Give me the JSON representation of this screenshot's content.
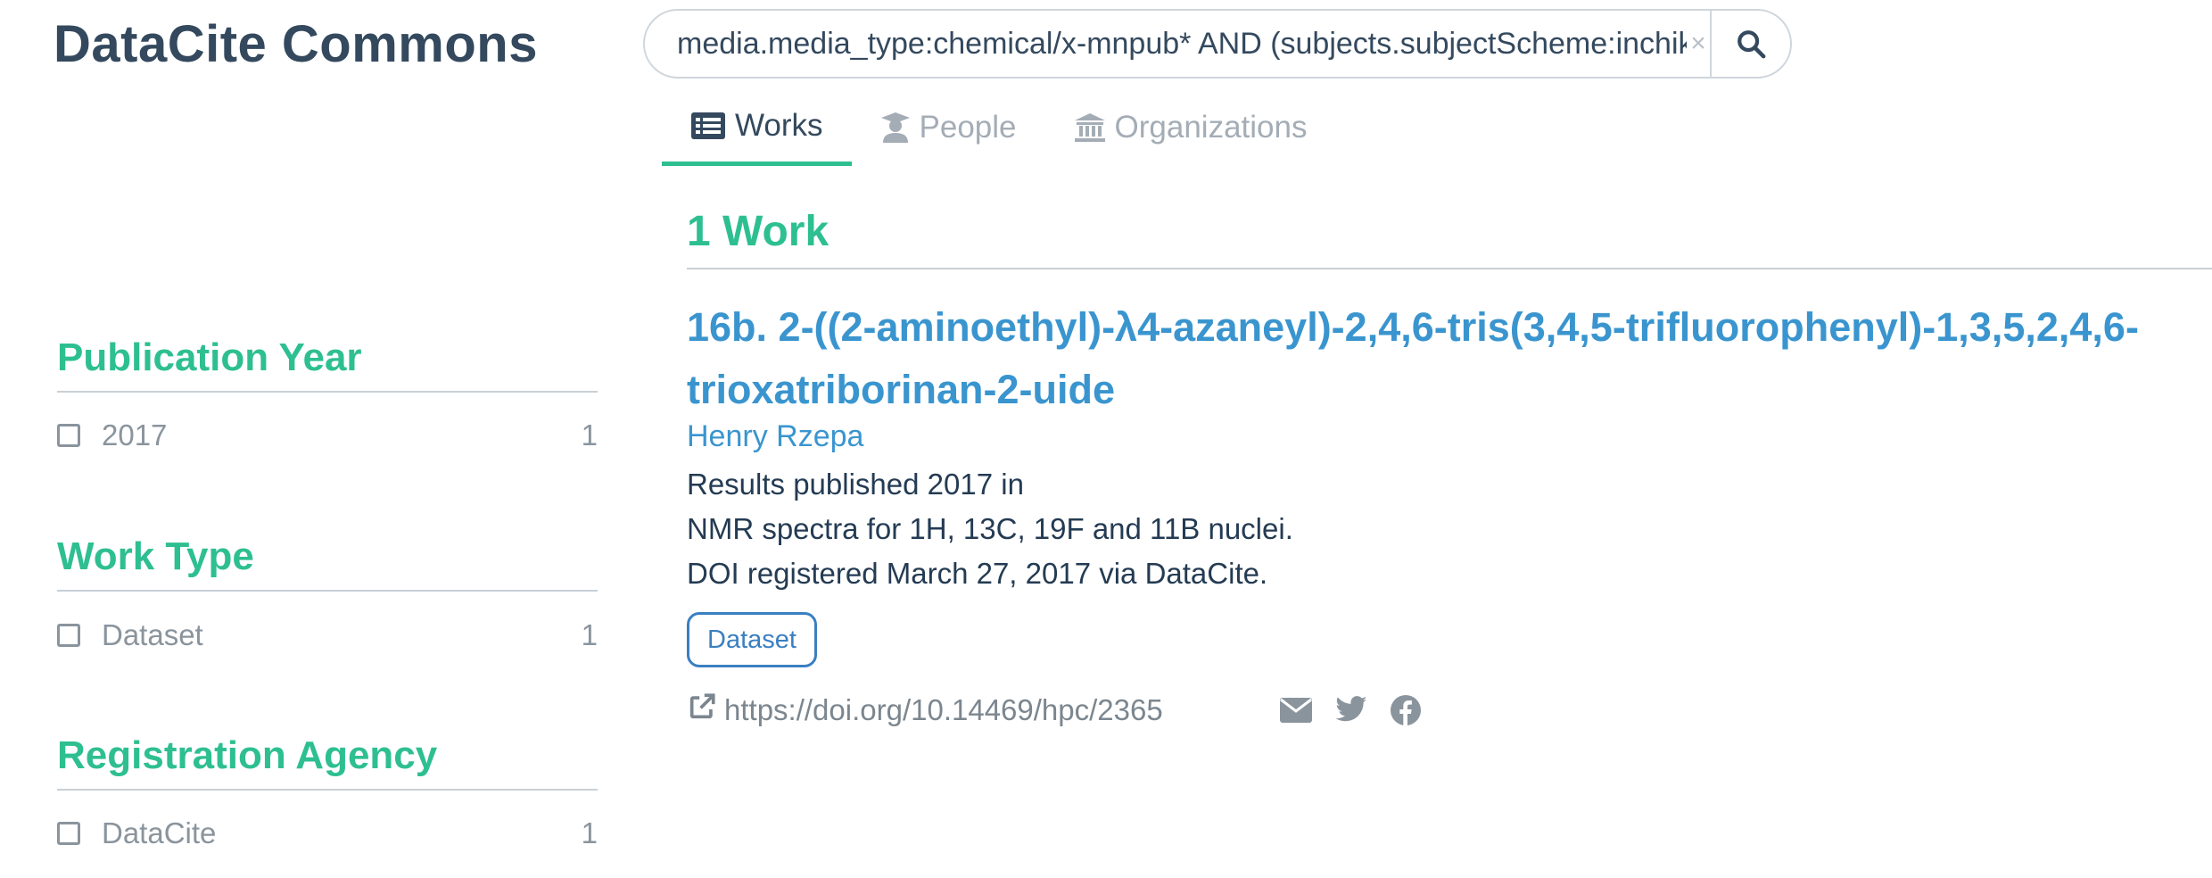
{
  "brand": "DataCite Commons",
  "search": {
    "value": "media.media_type:chemical/x-mnpub* AND (subjects.subjectScheme:inchikey)"
  },
  "tabs": [
    {
      "label": "Works",
      "icon": "list-alt-icon"
    },
    {
      "label": "People",
      "icon": "user-graduate-icon"
    },
    {
      "label": "Organizations",
      "icon": "university-icon"
    }
  ],
  "results": {
    "count_label": "1 Work"
  },
  "facets": [
    {
      "title": "Publication Year",
      "items": [
        {
          "label": "2017",
          "count": "1"
        }
      ]
    },
    {
      "title": "Work Type",
      "items": [
        {
          "label": "Dataset",
          "count": "1"
        }
      ]
    },
    {
      "title": "Registration Agency",
      "items": [
        {
          "label": "DataCite",
          "count": "1"
        }
      ]
    }
  ],
  "work": {
    "title_line1": "16b. 2-((2-aminoethyl)-λ4-azaneyl)-2,4,6-tris(3,4,5-trifluorophenyl)-1,3,5,2,4,6-",
    "title_line2": "trioxatriborinan-2-uide",
    "creator": "Henry Rzepa",
    "published": "Results published 2017 in",
    "description": "NMR spectra for 1H, 13C, 19F and 11B nuclei.",
    "registered": "DOI registered March 27, 2017 via DataCite.",
    "type_badge": "Dataset",
    "doi_url": "https://doi.org/10.14469/hpc/2365"
  },
  "colors": {
    "accent": "#2ebf91",
    "link": "#3a95cf",
    "brand_text": "#34495e",
    "muted": "#8a949d"
  }
}
